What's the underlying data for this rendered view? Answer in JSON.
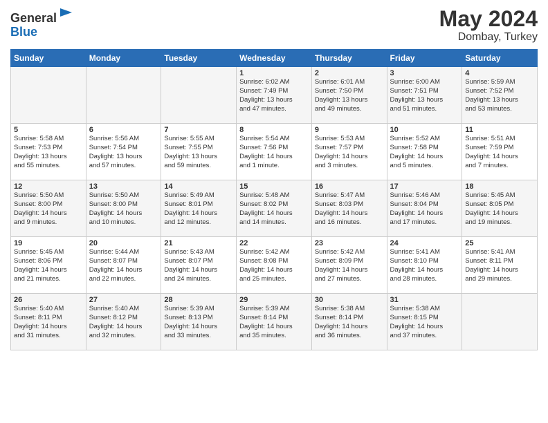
{
  "header": {
    "logo_general": "General",
    "logo_blue": "Blue",
    "title": "May 2024",
    "location": "Dombay, Turkey"
  },
  "columns": [
    "Sunday",
    "Monday",
    "Tuesday",
    "Wednesday",
    "Thursday",
    "Friday",
    "Saturday"
  ],
  "weeks": [
    [
      {
        "day": "",
        "lines": []
      },
      {
        "day": "",
        "lines": []
      },
      {
        "day": "",
        "lines": []
      },
      {
        "day": "1",
        "lines": [
          "Sunrise: 6:02 AM",
          "Sunset: 7:49 PM",
          "Daylight: 13 hours",
          "and 47 minutes."
        ]
      },
      {
        "day": "2",
        "lines": [
          "Sunrise: 6:01 AM",
          "Sunset: 7:50 PM",
          "Daylight: 13 hours",
          "and 49 minutes."
        ]
      },
      {
        "day": "3",
        "lines": [
          "Sunrise: 6:00 AM",
          "Sunset: 7:51 PM",
          "Daylight: 13 hours",
          "and 51 minutes."
        ]
      },
      {
        "day": "4",
        "lines": [
          "Sunrise: 5:59 AM",
          "Sunset: 7:52 PM",
          "Daylight: 13 hours",
          "and 53 minutes."
        ]
      }
    ],
    [
      {
        "day": "5",
        "lines": [
          "Sunrise: 5:58 AM",
          "Sunset: 7:53 PM",
          "Daylight: 13 hours",
          "and 55 minutes."
        ]
      },
      {
        "day": "6",
        "lines": [
          "Sunrise: 5:56 AM",
          "Sunset: 7:54 PM",
          "Daylight: 13 hours",
          "and 57 minutes."
        ]
      },
      {
        "day": "7",
        "lines": [
          "Sunrise: 5:55 AM",
          "Sunset: 7:55 PM",
          "Daylight: 13 hours",
          "and 59 minutes."
        ]
      },
      {
        "day": "8",
        "lines": [
          "Sunrise: 5:54 AM",
          "Sunset: 7:56 PM",
          "Daylight: 14 hours",
          "and 1 minute."
        ]
      },
      {
        "day": "9",
        "lines": [
          "Sunrise: 5:53 AM",
          "Sunset: 7:57 PM",
          "Daylight: 14 hours",
          "and 3 minutes."
        ]
      },
      {
        "day": "10",
        "lines": [
          "Sunrise: 5:52 AM",
          "Sunset: 7:58 PM",
          "Daylight: 14 hours",
          "and 5 minutes."
        ]
      },
      {
        "day": "11",
        "lines": [
          "Sunrise: 5:51 AM",
          "Sunset: 7:59 PM",
          "Daylight: 14 hours",
          "and 7 minutes."
        ]
      }
    ],
    [
      {
        "day": "12",
        "lines": [
          "Sunrise: 5:50 AM",
          "Sunset: 8:00 PM",
          "Daylight: 14 hours",
          "and 9 minutes."
        ]
      },
      {
        "day": "13",
        "lines": [
          "Sunrise: 5:50 AM",
          "Sunset: 8:00 PM",
          "Daylight: 14 hours",
          "and 10 minutes."
        ]
      },
      {
        "day": "14",
        "lines": [
          "Sunrise: 5:49 AM",
          "Sunset: 8:01 PM",
          "Daylight: 14 hours",
          "and 12 minutes."
        ]
      },
      {
        "day": "15",
        "lines": [
          "Sunrise: 5:48 AM",
          "Sunset: 8:02 PM",
          "Daylight: 14 hours",
          "and 14 minutes."
        ]
      },
      {
        "day": "16",
        "lines": [
          "Sunrise: 5:47 AM",
          "Sunset: 8:03 PM",
          "Daylight: 14 hours",
          "and 16 minutes."
        ]
      },
      {
        "day": "17",
        "lines": [
          "Sunrise: 5:46 AM",
          "Sunset: 8:04 PM",
          "Daylight: 14 hours",
          "and 17 minutes."
        ]
      },
      {
        "day": "18",
        "lines": [
          "Sunrise: 5:45 AM",
          "Sunset: 8:05 PM",
          "Daylight: 14 hours",
          "and 19 minutes."
        ]
      }
    ],
    [
      {
        "day": "19",
        "lines": [
          "Sunrise: 5:45 AM",
          "Sunset: 8:06 PM",
          "Daylight: 14 hours",
          "and 21 minutes."
        ]
      },
      {
        "day": "20",
        "lines": [
          "Sunrise: 5:44 AM",
          "Sunset: 8:07 PM",
          "Daylight: 14 hours",
          "and 22 minutes."
        ]
      },
      {
        "day": "21",
        "lines": [
          "Sunrise: 5:43 AM",
          "Sunset: 8:07 PM",
          "Daylight: 14 hours",
          "and 24 minutes."
        ]
      },
      {
        "day": "22",
        "lines": [
          "Sunrise: 5:42 AM",
          "Sunset: 8:08 PM",
          "Daylight: 14 hours",
          "and 25 minutes."
        ]
      },
      {
        "day": "23",
        "lines": [
          "Sunrise: 5:42 AM",
          "Sunset: 8:09 PM",
          "Daylight: 14 hours",
          "and 27 minutes."
        ]
      },
      {
        "day": "24",
        "lines": [
          "Sunrise: 5:41 AM",
          "Sunset: 8:10 PM",
          "Daylight: 14 hours",
          "and 28 minutes."
        ]
      },
      {
        "day": "25",
        "lines": [
          "Sunrise: 5:41 AM",
          "Sunset: 8:11 PM",
          "Daylight: 14 hours",
          "and 29 minutes."
        ]
      }
    ],
    [
      {
        "day": "26",
        "lines": [
          "Sunrise: 5:40 AM",
          "Sunset: 8:11 PM",
          "Daylight: 14 hours",
          "and 31 minutes."
        ]
      },
      {
        "day": "27",
        "lines": [
          "Sunrise: 5:40 AM",
          "Sunset: 8:12 PM",
          "Daylight: 14 hours",
          "and 32 minutes."
        ]
      },
      {
        "day": "28",
        "lines": [
          "Sunrise: 5:39 AM",
          "Sunset: 8:13 PM",
          "Daylight: 14 hours",
          "and 33 minutes."
        ]
      },
      {
        "day": "29",
        "lines": [
          "Sunrise: 5:39 AM",
          "Sunset: 8:14 PM",
          "Daylight: 14 hours",
          "and 35 minutes."
        ]
      },
      {
        "day": "30",
        "lines": [
          "Sunrise: 5:38 AM",
          "Sunset: 8:14 PM",
          "Daylight: 14 hours",
          "and 36 minutes."
        ]
      },
      {
        "day": "31",
        "lines": [
          "Sunrise: 5:38 AM",
          "Sunset: 8:15 PM",
          "Daylight: 14 hours",
          "and 37 minutes."
        ]
      },
      {
        "day": "",
        "lines": []
      }
    ]
  ]
}
